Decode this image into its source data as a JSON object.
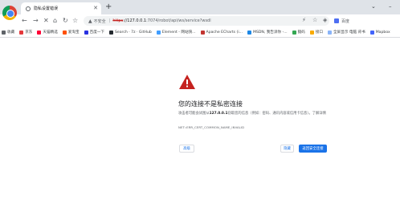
{
  "tab": {
    "title": "隐私设置错误",
    "close_glyph": "✕",
    "new_tab_glyph": "+"
  },
  "window_controls": {
    "dropdown_glyph": "⌄",
    "minimize_glyph": "–"
  },
  "toolbar": {
    "back_glyph": "←",
    "forward_glyph": "→",
    "stop_glyph": "✕",
    "home_glyph": "⌂",
    "reload_glyph": "↻",
    "star_glyph": "☆",
    "warning_glyph": "▲",
    "not_secure_label": "不安全",
    "divider": "|",
    "url_scheme": "https",
    "url_host": "://127.0.0.1",
    "url_path": ":7074/robot/api/ws/service?wsdl",
    "translate_glyph": "⚡",
    "bookmark_glyph": "☆",
    "extension_glyph": "◈"
  },
  "search": {
    "placeholder": "百度"
  },
  "bookmarks": [
    {
      "label": "收藏",
      "icon": "apps-icon",
      "color": "#5f6368"
    },
    {
      "label": "京东",
      "icon": "jd-icon",
      "color": "#e4393c"
    },
    {
      "label": "天猫精选",
      "icon": "tmall-icon",
      "color": "#ff0036"
    },
    {
      "label": "爱淘宝",
      "icon": "taobao-icon",
      "color": "#ff5000"
    },
    {
      "label": "百度一下",
      "icon": "baidu-icon",
      "color": "#2932e1"
    },
    {
      "label": "Search · 7z · GitHub",
      "icon": "github-icon",
      "color": "#24292f"
    },
    {
      "label": "Element - 网站快...",
      "icon": "element-icon",
      "color": "#409eff"
    },
    {
      "label": "Apache ECharts (i...",
      "icon": "echarts-icon",
      "color": "#c23531"
    },
    {
      "label": "MSDN, 我告诉你 -...",
      "icon": "msdn-icon",
      "color": "#1e88e5"
    },
    {
      "label": "猿码",
      "icon": "yuanma-icon",
      "color": "#34a853"
    },
    {
      "label": "接口",
      "icon": "folder-icon",
      "color": "#f9ab00"
    },
    {
      "label": "全屏显示 电脑 背书",
      "icon": "screen-icon",
      "color": "#8ab4f8"
    },
    {
      "label": "Mapbox",
      "icon": "mapbox-icon",
      "color": "#4264fb"
    }
  ],
  "error": {
    "title": "您的连接不是私密连接",
    "body_prefix": "攻击者可能会试图从",
    "body_host": "127.0.0.1",
    "body_suffix": "窃取您的信息（例如：密码、通讯内容或信用卡信息）。了解详情",
    "code": "NET::ERR_CERT_COMMON_NAME_INVALID",
    "advanced_label": "高级",
    "hide_label": "隐藏",
    "back_label": "返回安全连接",
    "icon_color": "#c5221f"
  }
}
